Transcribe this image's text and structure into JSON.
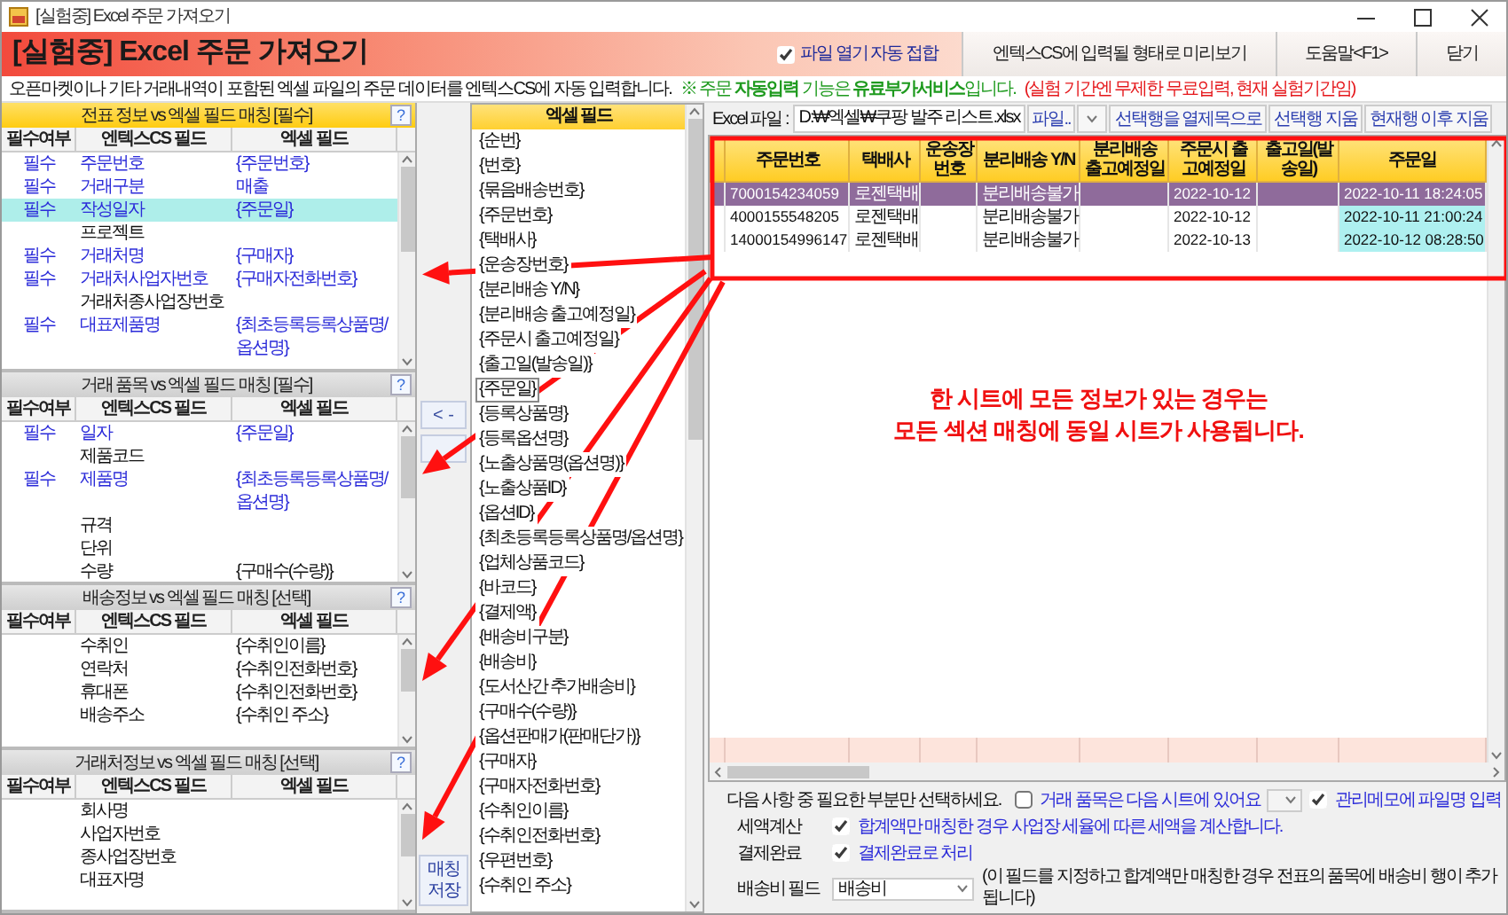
{
  "window": {
    "title": "[실험중] Excel 주문 가져오기"
  },
  "header": {
    "title": "[실험중] Excel 주문 가져오기",
    "auto_open": {
      "label": "파일 열기 자동 접합",
      "checked": true
    },
    "buttons": [
      "엔텍스CS에 입력될 형태로 미리보기",
      "도움말<F1>",
      "닫기"
    ]
  },
  "notice": {
    "text": "오픈마켓이나 기타 거래내역이 포함된 엑셀 파일의 주문 데이터를 엔텍스CS에 자동 입력합니다.",
    "paid_note": "※ 주문 **자동입력** 기능은 **유료부가서비스**입니다.",
    "trial_note": "(실험 기간엔 무제한 무료입력, 현재 실험기간임)"
  },
  "panels": [
    {
      "title": "전표 정보 vs 엑셀 필드 매칭 [필수]",
      "help": "?",
      "active": true,
      "columns": [
        "필수여부",
        "엔텍스CS 필드",
        "엑셀 필드"
      ],
      "rows": [
        {
          "required": "필수",
          "field": "주문번호",
          "excel": "{주문번호}",
          "selected": false
        },
        {
          "required": "필수",
          "field": "거래구분",
          "excel": "매출",
          "selected": false
        },
        {
          "required": "필수",
          "field": "작성일자",
          "excel": "{주문일}",
          "selected": true
        },
        {
          "field": "프로젝트",
          "selected": false
        },
        {
          "required": "필수",
          "field": "거래처명",
          "excel": "{구매자}",
          "selected": false
        },
        {
          "required": "필수",
          "field": "거래처사업자번호",
          "excel": "{구매자전화번호}",
          "selected": false
        },
        {
          "field": "거래처종사업장번호",
          "selected": false
        },
        {
          "required": "필수",
          "field": "대표제품명",
          "excel": "{최초등록등록상품명/옵션명}",
          "selected": false
        }
      ]
    },
    {
      "title": "거래 품목 vs 엑셀 필드 매칭 [필수]",
      "help": "?",
      "active": false,
      "columns": [
        "필수여부",
        "엔텍스CS 필드",
        "엑셀 필드"
      ],
      "rows": [
        {
          "required": "필수",
          "field": "일자",
          "excel": "{주문일}",
          "selected": false
        },
        {
          "field": "제품코드",
          "selected": false
        },
        {
          "required": "필수",
          "field": "제품명",
          "excel": "{최초등록등록상품명/옵션명}",
          "selected": false
        },
        {
          "field": "규격",
          "selected": false
        },
        {
          "field": "단위",
          "selected": false
        },
        {
          "field": "수량",
          "excel": "{구매수(수량)}",
          "selected": false
        }
      ]
    },
    {
      "title": "배송정보 vs 엑셀 필드 매칭 [선택]",
      "help": "?",
      "active": false,
      "columns": [
        "필수여부",
        "엔텍스CS 필드",
        "엑셀 필드"
      ],
      "rows": [
        {
          "field": "수취인",
          "excel": "{수취인이름}",
          "selected": false
        },
        {
          "field": "연락처",
          "excel": "{수취인전화번호}",
          "selected": false
        },
        {
          "field": "휴대폰",
          "excel": "{수취인전화번호}",
          "selected": false
        },
        {
          "field": "배송주소",
          "excel": "{수취인 주소}",
          "selected": false
        }
      ]
    },
    {
      "title": "거래처정보 vs 엑셀 필드 매칭 [선택]",
      "help": "?",
      "active": false,
      "columns": [
        "필수여부",
        "엔텍스CS 필드",
        "엑셀 필드"
      ],
      "rows": [
        {
          "field": "회사명",
          "selected": false
        },
        {
          "field": "사업자번호",
          "selected": false
        },
        {
          "field": "종사업장번호",
          "selected": false
        },
        {
          "field": "대표자명",
          "selected": false
        }
      ]
    }
  ],
  "move_button": "< -",
  "save_button": "매칭저장",
  "excel_fields": {
    "header": "엑셀 필드",
    "items": [
      {
        "label": "{순번}",
        "selected": false
      },
      {
        "label": "{번호}",
        "selected": false
      },
      {
        "label": "{묶음배송번호}",
        "selected": false
      },
      {
        "label": "{주문번호}",
        "selected": false
      },
      {
        "label": "{택배사}",
        "selected": false
      },
      {
        "label": "{운송장번호}",
        "selected": false
      },
      {
        "label": "{분리배송 Y/N}",
        "selected": false
      },
      {
        "label": "{분리배송 출고예정일}",
        "selected": false
      },
      {
        "label": "{주문시 출고예정일}",
        "selected": false
      },
      {
        "label": "{출고일(발송일)}",
        "selected": false
      },
      {
        "label": "{주문일}",
        "selected": true
      },
      {
        "label": "{등록상품명}",
        "selected": false
      },
      {
        "label": "{등록옵션명}",
        "selected": false
      },
      {
        "label": "{노출상품명(옵션명)}",
        "selected": false
      },
      {
        "label": "{노출상품ID}",
        "selected": false
      },
      {
        "label": "{옵션ID}",
        "selected": false
      },
      {
        "label": "{최초등록등록상품명/옵션명}",
        "selected": false
      },
      {
        "label": "{업체상품코드}",
        "selected": false
      },
      {
        "label": "{바코드}",
        "selected": false
      },
      {
        "label": "{결제액}",
        "selected": false
      },
      {
        "label": "{배송비구분}",
        "selected": false
      },
      {
        "label": "{배송비}",
        "selected": false
      },
      {
        "label": "{도서산간 추가배송비}",
        "selected": false
      },
      {
        "label": "{구매수(수량)}",
        "selected": false
      },
      {
        "label": "{옵션판매가(판매단가)}",
        "selected": false
      },
      {
        "label": "{구매자}",
        "selected": false
      },
      {
        "label": "{구매자전화번호}",
        "selected": false
      },
      {
        "label": "{수취인이름}",
        "selected": false
      },
      {
        "label": "{수취인전화번호}",
        "selected": false
      },
      {
        "label": "{우편번호}",
        "selected": false
      },
      {
        "label": "{수취인 주소}",
        "selected": false
      }
    ]
  },
  "file": {
    "label": "Excel 파일 :",
    "path": "D:₩엑셀₩쿠팡 발주 리스트.xlsx",
    "buttons": [
      "파일..",
      "선택행을 열제목으로",
      "선택행 지움",
      "현재행 이후 지움"
    ]
  },
  "grid": {
    "columns": [
      "주문번호",
      "택배사",
      "운송장번호",
      "분리배송 Y/N",
      "분리배송 출고예정일",
      "주문시 출고예정일",
      "출고일(발송일)",
      "주문일"
    ],
    "rows": [
      {
        "cells": [
          "7000154234059",
          "로젠택배",
          null,
          "분리배송불가",
          null,
          "2022-10-12",
          null,
          "2022-10-11 18:24:05"
        ],
        "selected": true,
        "highlighted": false
      },
      {
        "cells": [
          "4000155548205",
          "로젠택배",
          null,
          "분리배송불가",
          null,
          "2022-10-12",
          null,
          "2022-10-11 21:00:24"
        ],
        "selected": false,
        "highlighted": true
      },
      {
        "cells": [
          "14000154996147",
          "로젠택배",
          null,
          "분리배송불가",
          null,
          "2022-10-13",
          null,
          "2022-10-12 08:28:50"
        ],
        "selected": false,
        "highlighted": true
      }
    ]
  },
  "annotation": {
    "lines": [
      "한 시트에 모든 정보가 있는 경우는",
      "모든 섹션 매칭에 동일 시트가 사용됩니다."
    ]
  },
  "options": {
    "prompt": "다음 사항 중 필요한 부분만 선택하세요.",
    "next_sheet": {
      "label": "거래 품목은 다음 시트에 있어요",
      "checked": false
    },
    "memo": {
      "label": "관리메모에 파일명 입력",
      "checked": true
    },
    "tax": {
      "label": "세액계산",
      "option": {
        "label": "합계액만 매칭한 경우 사업장 세율에 따른 세액을 계산합니다.",
        "checked": true
      }
    },
    "payment": {
      "label": "결제완료",
      "option": {
        "label": "결제완료로 처리",
        "checked": true
      }
    },
    "shipping_fee": {
      "label": "배송비 필드",
      "value": "배송비",
      "hint": "(이 필드를 지정하고 합계액만 매칭한 경우 전표의 품목에 배송비 행이 추가됩니다)"
    }
  }
}
